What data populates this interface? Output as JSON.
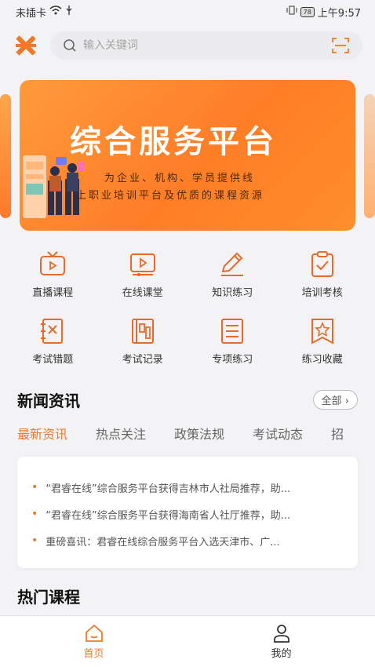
{
  "status_bar": {
    "left": "未插卡",
    "battery": "78",
    "time": "上午9:57"
  },
  "search": {
    "placeholder": "输入关键词"
  },
  "banner": {
    "title": "综合服务平台",
    "subtitle_line1": "为企业、机构、学员提供线",
    "subtitle_line2": "上职业培训平台及优质的课程资源"
  },
  "grid": {
    "items": [
      {
        "label": "直播课程",
        "icon": "tv-icon"
      },
      {
        "label": "在线课堂",
        "icon": "video-icon"
      },
      {
        "label": "知识练习",
        "icon": "pencil-icon"
      },
      {
        "label": "培训考核",
        "icon": "clipboard-check-icon"
      },
      {
        "label": "考试错题",
        "icon": "wrong-book-icon"
      },
      {
        "label": "考试记录",
        "icon": "record-book-icon"
      },
      {
        "label": "专项练习",
        "icon": "list-doc-icon"
      },
      {
        "label": "练习收藏",
        "icon": "star-bookmark-icon"
      }
    ]
  },
  "news": {
    "title": "新闻资讯",
    "all_label": "全部",
    "tabs": [
      "最新资讯",
      "热点关注",
      "政策法规",
      "考试动态",
      "招"
    ],
    "items": [
      "“君睿在线”综合服务平台获得吉林市人社局推荐，助...",
      "“君睿在线”综合服务平台获得海南省人社厅推荐，助...",
      "重磅喜讯：君睿在线综合服务平台入选天津市、广..."
    ]
  },
  "hot_courses": {
    "title": "热门课程"
  },
  "bottom_nav": {
    "home": "首页",
    "mine": "我的"
  },
  "colors": {
    "accent": "#f0782a",
    "icon_stroke": "#e86a2a"
  }
}
